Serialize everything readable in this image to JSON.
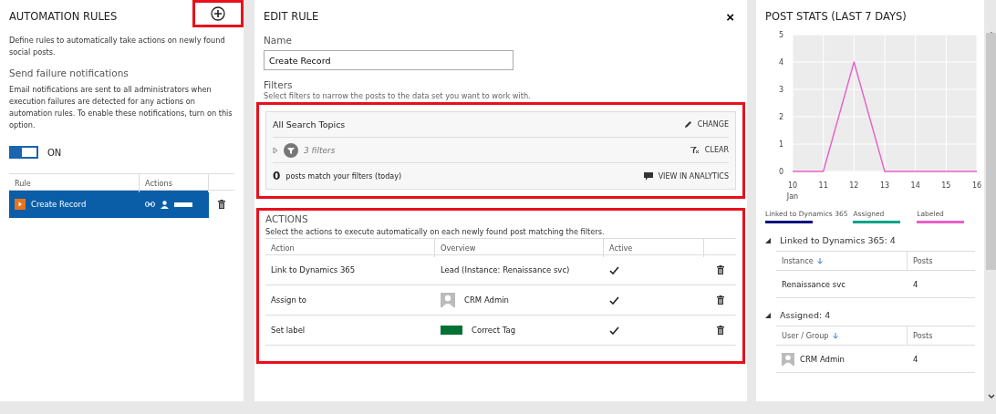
{
  "rules_panel": {
    "title": "AUTOMATION RULES",
    "add_highlighted": true,
    "description": "Define rules to automatically take actions on newly found social posts.",
    "notifications": {
      "heading": "Send failure notifications",
      "text": "Email notifications are sent to all administrators when execution failures are detected for any actions on automation rules. To enable these notifications, turn on this option.",
      "on": true,
      "state_label": "ON"
    },
    "table": {
      "columns": [
        "Rule",
        "Actions"
      ],
      "rows": [
        {
          "name": "Create Record",
          "selected": true
        }
      ]
    }
  },
  "edit_rule": {
    "title": "EDIT RULE",
    "close": "×",
    "name_label": "Name",
    "name_value": "Create Record",
    "filters_label": "Filters",
    "filters_hint": "Select filters to narrow the posts to the data set you want to work with.",
    "filters": {
      "highlighted": true,
      "topics": "All Search Topics",
      "change": "CHANGE",
      "filter_count": "3 filters",
      "clear": "CLEAR",
      "match_count": "0",
      "match_text": "posts match your filters (today)",
      "analytics": "VIEW IN ANALYTICS"
    },
    "actions": {
      "highlighted": true,
      "title": "ACTIONS",
      "hint": "Select the actions to execute automatically on each newly found post matching the filters.",
      "columns": [
        "Action",
        "Overview",
        "Active"
      ],
      "rows": [
        {
          "action": "Link to Dynamics 365",
          "kind": "text",
          "overview": "Lead (Instance: Renaissance svc)",
          "active": true
        },
        {
          "action": "Assign to",
          "kind": "user",
          "overview": "CRM Admin",
          "active": true
        },
        {
          "action": "Set label",
          "kind": "label",
          "overview": "Correct Tag",
          "color": "#007233",
          "active": true
        }
      ]
    }
  },
  "stats": {
    "title": "POST STATS (LAST 7 DAYS)",
    "month_label": "Jan",
    "chart_data": {
      "type": "line",
      "grid": true,
      "categories": [
        "10",
        "11",
        "12",
        "13",
        "14",
        "15",
        "16"
      ],
      "ylim": [
        0,
        5
      ],
      "yticks": [
        0,
        1,
        2,
        3,
        4,
        5
      ],
      "series": [
        {
          "name": "Linked to Dynamics 365",
          "color": "#00137f",
          "values": [
            null,
            null,
            null,
            null,
            null,
            null,
            null
          ]
        },
        {
          "name": "Assigned",
          "color": "#00a388",
          "values": [
            null,
            null,
            null,
            null,
            null,
            null,
            null
          ]
        },
        {
          "name": "Labeled",
          "color": "#e760c7",
          "values": [
            0,
            0,
            4,
            0,
            0,
            0,
            0
          ]
        }
      ]
    },
    "sections": [
      {
        "title": "Linked to Dynamics 365: 4",
        "expanded": true,
        "columns": [
          "Instance",
          "Posts"
        ],
        "rows": [
          {
            "kind": "plain",
            "name": "Renaissance svc",
            "posts": "4"
          }
        ]
      },
      {
        "title": "Assigned: 4",
        "expanded": true,
        "columns": [
          "User / Group",
          "Posts"
        ],
        "rows": [
          {
            "kind": "user",
            "name": "CRM Admin",
            "posts": "4"
          }
        ]
      }
    ]
  }
}
